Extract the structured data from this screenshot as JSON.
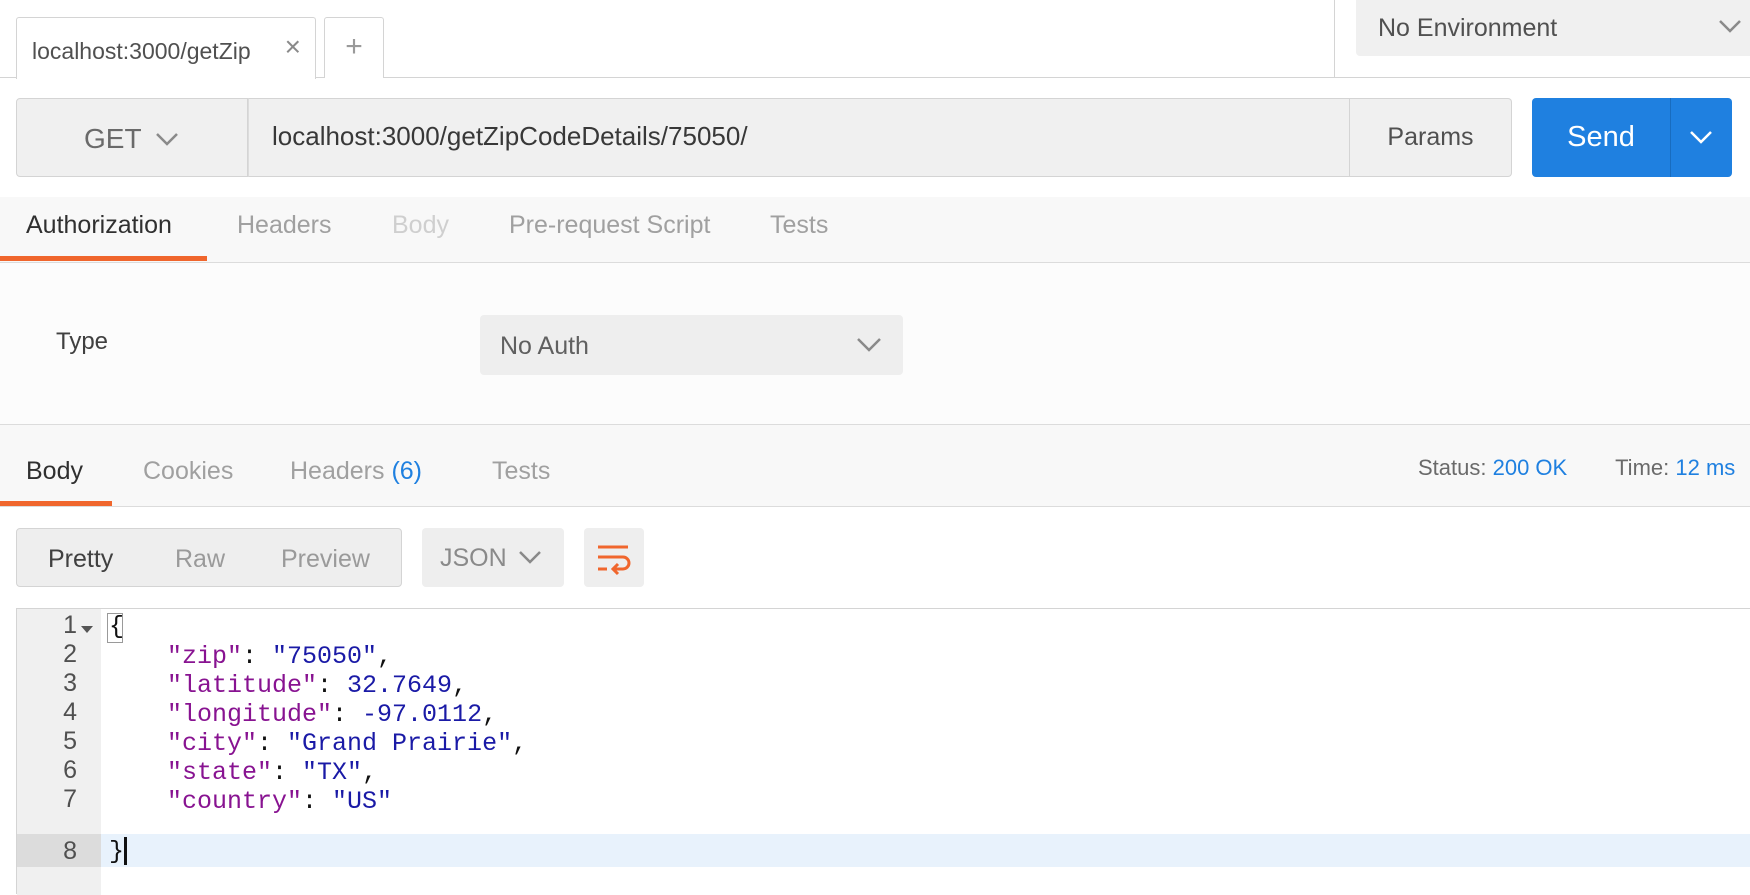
{
  "tabs": {
    "request_tab_label": "localhost:3000/getZip",
    "close_glyph": "×",
    "new_tab_glyph": "+"
  },
  "environment": {
    "label": "No Environment"
  },
  "request": {
    "method": "GET",
    "url": "localhost:3000/getZipCodeDetails/75050/",
    "params_label": "Params",
    "send_label": "Send"
  },
  "request_tabs": [
    {
      "label": "Authorization",
      "active": true
    },
    {
      "label": "Headers"
    },
    {
      "label": "Body",
      "disabled": true
    },
    {
      "label": "Pre-request Script"
    },
    {
      "label": "Tests"
    }
  ],
  "auth": {
    "type_label": "Type",
    "selected": "No Auth"
  },
  "response_tabs": [
    {
      "label": "Body",
      "active": true
    },
    {
      "label": "Cookies"
    },
    {
      "label": "Headers",
      "count": "(6)"
    },
    {
      "label": "Tests"
    }
  ],
  "status": {
    "status_label": "Status:",
    "status_value": "200 OK",
    "time_label": "Time:",
    "time_value": "12 ms"
  },
  "view_modes": [
    "Pretty",
    "Raw",
    "Preview"
  ],
  "format": {
    "selected": "JSON"
  },
  "code": {
    "line_numbers": [
      "1",
      "2",
      "3",
      "4",
      "5",
      "6",
      "7",
      "8"
    ],
    "open_brace": "{",
    "close_brace": "}",
    "fields": [
      {
        "key": "\"zip\"",
        "value": "\"75050\"",
        "value_type": "string",
        "trail": ","
      },
      {
        "key": "\"latitude\"",
        "value": "32.7649",
        "value_type": "number",
        "trail": ","
      },
      {
        "key": "\"longitude\"",
        "value": "-97.0112",
        "value_type": "number",
        "trail": ","
      },
      {
        "key": "\"city\"",
        "value": "\"Grand Prairie\"",
        "value_type": "string",
        "trail": ","
      },
      {
        "key": "\"state\"",
        "value": "\"TX\"",
        "value_type": "string",
        "trail": ","
      },
      {
        "key": "\"country\"",
        "value": "\"US\"",
        "value_type": "string",
        "trail": ""
      }
    ]
  },
  "colors": {
    "accent_blue": "#1f80e0",
    "tab_indicator": "#f0662d",
    "json_key": "#881391",
    "json_value": "#1a1aa6"
  },
  "icons": {
    "tab_close": "close-icon",
    "new_tab": "plus-icon",
    "dropdown": "chevron-down-icon",
    "wrap": "wrap-lines-icon",
    "fold": "fold-arrow-icon"
  }
}
